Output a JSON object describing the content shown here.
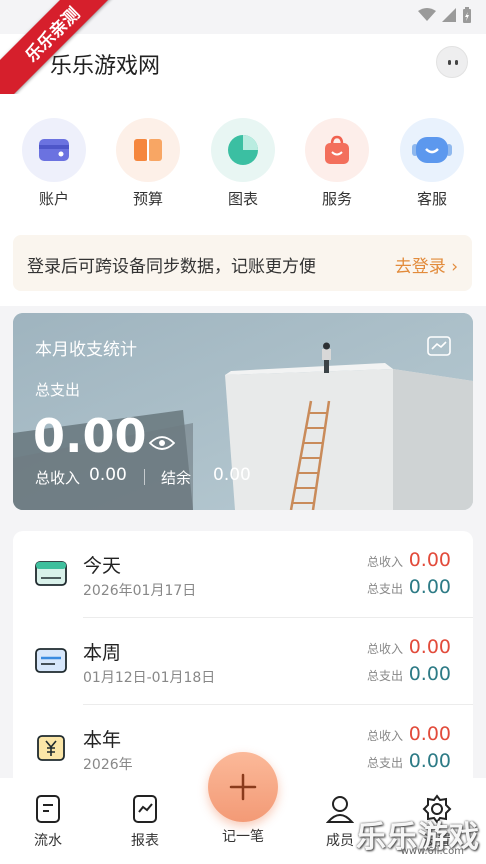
{
  "ribbon": "乐乐亲测",
  "header": {
    "title": "乐乐游戏网"
  },
  "quick": [
    {
      "label": "账户",
      "icon": "wallet-card-icon"
    },
    {
      "label": "预算",
      "icon": "budget-icon"
    },
    {
      "label": "图表",
      "icon": "pie-chart-icon"
    },
    {
      "label": "服务",
      "icon": "shopping-bag-icon"
    },
    {
      "label": "客服",
      "icon": "customer-service-icon"
    }
  ],
  "login": {
    "text": "登录后可跨设备同步数据，记账更方便",
    "link": "去登录"
  },
  "stats": {
    "title": "本月收支统计",
    "expense_label": "总支出",
    "expense_value": "0.00",
    "income_label": "总收入",
    "income_value": "0.00",
    "balance_label": "结余",
    "balance_value": "0.00"
  },
  "periods": [
    {
      "name": "今天",
      "date": "2026年01月17日",
      "in_label": "总收入",
      "in": "0.00",
      "out_label": "总支出",
      "out": "0.00"
    },
    {
      "name": "本周",
      "date": "01月12日-01月18日",
      "in_label": "总收入",
      "in": "0.00",
      "out_label": "总支出",
      "out": "0.00"
    },
    {
      "name": "本年",
      "date": "2026年",
      "in_label": "总收入",
      "in": "0.00",
      "out_label": "总支出",
      "out": "0.00"
    }
  ],
  "nav": [
    {
      "label": "流水",
      "icon": "bill-list-icon"
    },
    {
      "label": "报表",
      "icon": "report-icon"
    },
    {
      "label": "记一笔",
      "icon": "plus-icon"
    },
    {
      "label": "成员",
      "icon": "member-icon"
    },
    {
      "label": "设置",
      "icon": "settings-icon"
    }
  ],
  "watermark": {
    "text": "乐乐游戏",
    "url": "www.6ll.com"
  },
  "colors": {
    "accent": "#e28b3b",
    "income": "#e24b3b",
    "expense": "#2d7b86",
    "fab": "#f39a76"
  }
}
